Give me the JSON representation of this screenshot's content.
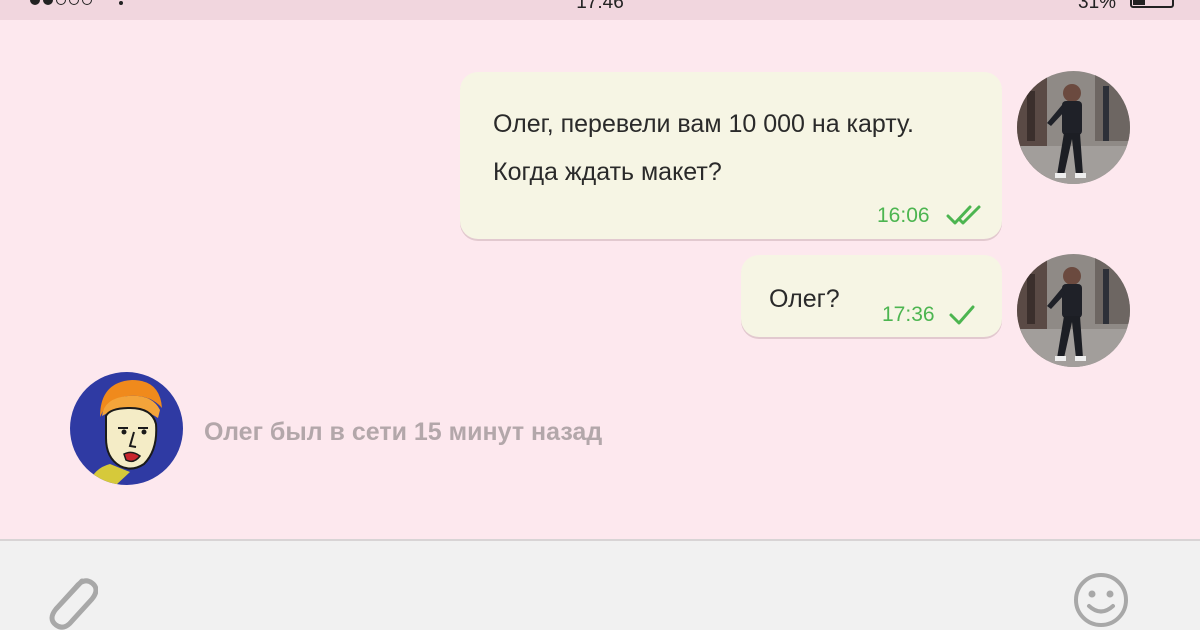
{
  "status_bar": {
    "time": "17:46",
    "battery": "31%",
    "icons": [
      "signal-dots-icon",
      "wifi-icon",
      "battery-icon"
    ]
  },
  "messages": [
    {
      "lines": [
        "Олег, перевели вам 10 000 на карту.",
        "Когда ждать макет?"
      ],
      "time": "16:06",
      "status_icon": "double-check-icon",
      "avatar": "sender-avatar-photo"
    },
    {
      "lines": [
        "Олег?"
      ],
      "time": "17:36",
      "status_icon": "single-check-icon",
      "avatar": "sender-avatar-photo"
    }
  ],
  "contact": {
    "avatar": "oleg-avatar-illustration",
    "presence": "Олег был в сети 15 минут назад"
  },
  "input_bar": {
    "attach_icon": "paperclip-icon",
    "emoji_icon": "smiley-icon"
  },
  "colors": {
    "background": "#fde8ee",
    "bubble": "#f6f5e4",
    "time_green": "#4cb550",
    "presence_grey": "#b3a7aa",
    "input_bar": "#f1f1f1"
  }
}
